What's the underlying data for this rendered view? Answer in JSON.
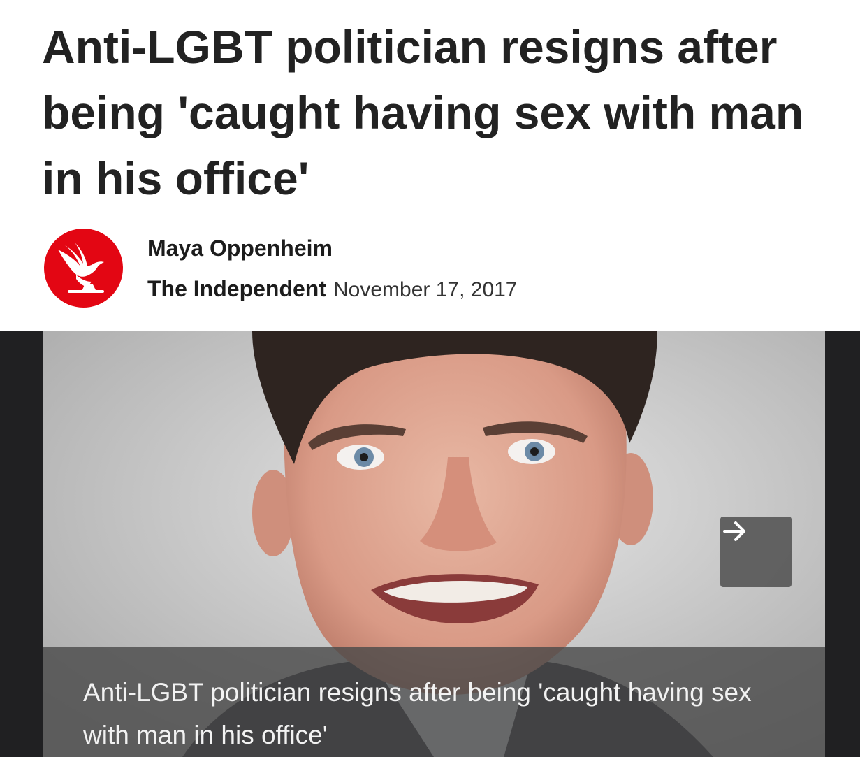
{
  "article": {
    "headline": "Anti-LGBT politician resigns after being 'caught having sex with man in his office'",
    "author": "Maya Oppenheim",
    "publisher": "The Independent",
    "date": "November 17, 2017"
  },
  "logo": {
    "icon": "eagle-icon",
    "color": "#e30613"
  },
  "media": {
    "caption": "Anti-LGBT politician resigns after being 'caught having sex with man in his office'",
    "next_icon": "arrow-right-icon"
  }
}
